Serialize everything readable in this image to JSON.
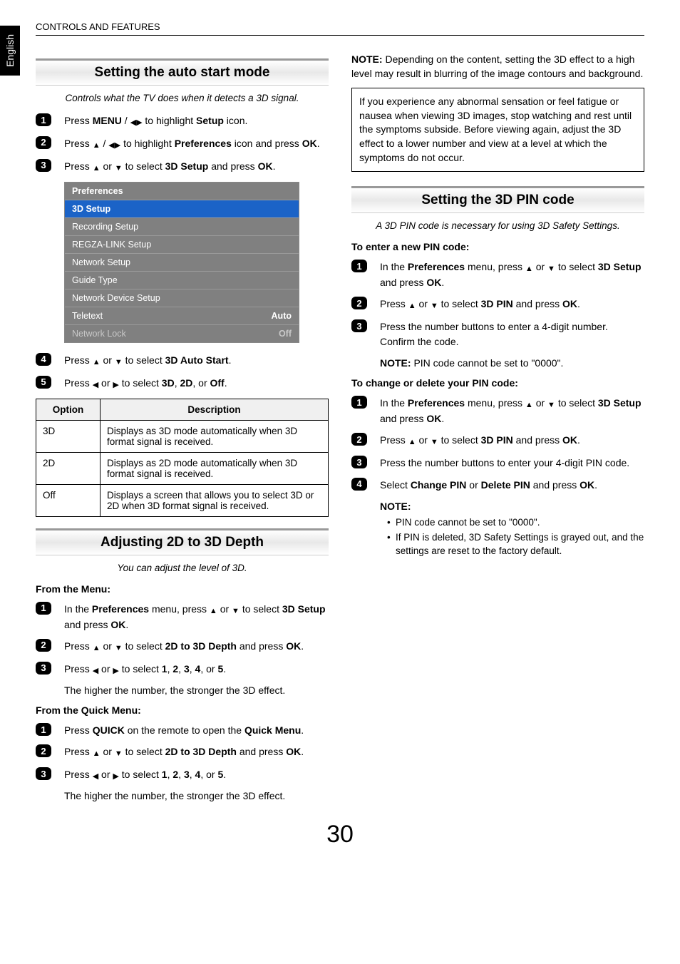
{
  "lang_tab": "English",
  "header": "CONTROLS AND FEATURES",
  "page_number": "30",
  "glyph": {
    "up": "▲",
    "down": "▼",
    "left": "◀",
    "right": "▶"
  },
  "left": {
    "s1": {
      "title": "Setting the auto start mode",
      "intro": "Controls what the TV does when it detects a 3D signal.",
      "step1_a": "Press ",
      "step1_menu": "MENU",
      "step1_b": " / ",
      "step1_c": " to highlight ",
      "step1_setup": "Setup",
      "step1_d": " icon.",
      "step2_a": "Press ",
      "step2_b": " / ",
      "step2_c": " to highlight ",
      "step2_pref": "Preferences",
      "step2_d": " icon and press ",
      "step2_ok": "OK",
      "step2_e": ".",
      "step3_a": "Press ",
      "step3_b": " or ",
      "step3_c": " to select ",
      "step3_3d": "3D Setup",
      "step3_d": " and press ",
      "step3_ok": "OK",
      "step3_e": ".",
      "osd": {
        "title": "Preferences",
        "rows": [
          {
            "label": "3D Setup",
            "val": "",
            "sel": true
          },
          {
            "label": "Recording Setup",
            "val": ""
          },
          {
            "label": "REGZA-LINK Setup",
            "val": ""
          },
          {
            "label": "Network Setup",
            "val": ""
          },
          {
            "label": "Guide Type",
            "val": ""
          },
          {
            "label": "Network Device Setup",
            "val": ""
          },
          {
            "label": "Teletext",
            "val": "Auto"
          },
          {
            "label": "Network Lock",
            "val": "Off",
            "dim": true
          }
        ]
      },
      "step4_a": "Press ",
      "step4_b": " or ",
      "step4_c": " to select ",
      "step4_auto": "3D Auto Start",
      "step4_d": ".",
      "step5_a": "Press ",
      "step5_b": " or ",
      "step5_c": " to select ",
      "step5_3d": "3D",
      "step5_comma1": ", ",
      "step5_2d": "2D",
      "step5_comma2": ", or ",
      "step5_off": "Off",
      "step5_d": ".",
      "table": {
        "h1": "Option",
        "h2": "Description",
        "rows": [
          {
            "opt": "3D",
            "desc": "Displays as 3D mode automatically when 3D format signal is received."
          },
          {
            "opt": "2D",
            "desc": "Displays as 2D mode automatically when 3D format signal is received."
          },
          {
            "opt": "Off",
            "desc": "Displays a screen that allows you to select 3D or 2D when 3D format signal is received."
          }
        ]
      }
    },
    "s2": {
      "title": "Adjusting 2D to 3D Depth",
      "intro": "You can adjust the level of 3D.",
      "h_menu": "From the Menu:",
      "m1_a": "In the ",
      "m1_pref": "Preferences",
      "m1_b": " menu, press ",
      "m1_c": " or ",
      "m1_d": " to select ",
      "m1_3d": "3D Setup",
      "m1_e": " and press ",
      "m1_ok": "OK",
      "m1_f": ".",
      "m2_a": "Press ",
      "m2_b": " or ",
      "m2_c": " to select ",
      "m2_depth": "2D to 3D Depth",
      "m2_d": " and press ",
      "m2_ok": "OK",
      "m2_e": ".",
      "m3_a": "Press ",
      "m3_b": " or ",
      "m3_c": " to select ",
      "m3_1": "1",
      "m3_s1": ", ",
      "m3_2": "2",
      "m3_s2": ", ",
      "m3_3": "3",
      "m3_s3": ", ",
      "m3_4": "4",
      "m3_s4": ", or ",
      "m3_5": "5",
      "m3_d": ".",
      "m3_effect": "The higher the number, the stronger the 3D effect.",
      "h_quick": "From the Quick Menu:",
      "q1_a": "Press ",
      "q1_quick": "QUICK",
      "q1_b": " on the remote to open the ",
      "q1_qmenu": "Quick Menu",
      "q1_c": ".",
      "q2_a": "Press ",
      "q2_b": " or ",
      "q2_c": " to select ",
      "q2_depth": "2D to 3D Depth",
      "q2_d": " and press ",
      "q2_ok": "OK",
      "q2_e": ".",
      "q3_a": "Press ",
      "q3_b": " or ",
      "q3_c": " to select ",
      "q3_1": "1",
      "q3_s1": ", ",
      "q3_2": "2",
      "q3_s2": ", ",
      "q3_3": "3",
      "q3_s3": ", ",
      "q3_4": "4",
      "q3_s4": ", or ",
      "q3_5": "5",
      "q3_d": ".",
      "q3_effect": "The higher the number, the stronger the 3D effect."
    }
  },
  "right": {
    "note_lead": "NOTE:",
    "note_body": " Depending on the content, setting the 3D effect to a high level may result in blurring of the image contours and background.",
    "warn": "If you experience any abnormal sensation or feel fatigue or nausea when viewing 3D images, stop watching and rest until the symptoms subside. Before viewing again, adjust the 3D effect to a lower number and view at a level at which the symptoms do not occur.",
    "s3": {
      "title": "Setting the 3D PIN code",
      "intro": "A 3D PIN code is necessary for using 3D Safety Settings.",
      "h_enter": "To enter a new PIN code:",
      "e1_a": "In the ",
      "e1_pref": "Preferences",
      "e1_b": " menu, press ",
      "e1_c": " or ",
      "e1_d": " to select ",
      "e1_3d": "3D Setup",
      "e1_e": " and press ",
      "e1_ok": "OK",
      "e1_f": ".",
      "e2_a": "Press ",
      "e2_b": " or ",
      "e2_c": " to select ",
      "e2_pin": "3D PIN",
      "e2_d": " and press ",
      "e2_ok": "OK",
      "e2_e": ".",
      "e3": "Press the number buttons to enter a 4-digit number. Confirm the code.",
      "e3_note_lead": "NOTE:",
      "e3_note_body": " PIN code cannot be set to \"0000\".",
      "h_change": "To change or delete your PIN code:",
      "c1_a": "In the ",
      "c1_pref": "Preferences",
      "c1_b": " menu, press ",
      "c1_c": " or ",
      "c1_d": " to select ",
      "c1_3d": "3D Setup",
      "c1_e": " and press ",
      "c1_ok": "OK",
      "c1_f": ".",
      "c2_a": "Press ",
      "c2_b": " or ",
      "c2_c": " to select ",
      "c2_pin": "3D PIN",
      "c2_d": " and press ",
      "c2_ok": "OK",
      "c2_e": ".",
      "c3": "Press the number buttons to enter your 4-digit PIN code.",
      "c4_a": "Select ",
      "c4_change": "Change PIN",
      "c4_b": " or ",
      "c4_delete": "Delete PIN",
      "c4_c": " and press ",
      "c4_ok": "OK",
      "c4_d": ".",
      "notes_head": "NOTE:",
      "notes": [
        "PIN code cannot be set to \"0000\".",
        "If PIN is deleted, 3D Safety Settings is grayed out, and the settings are reset to the factory default."
      ]
    }
  }
}
